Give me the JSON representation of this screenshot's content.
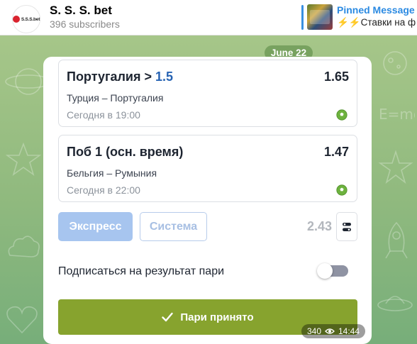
{
  "channel": {
    "title": "S. S. S. bet",
    "subscribers": "396 subscribers",
    "avatar_text": "S.S.S.bet"
  },
  "pinned": {
    "title": "Pinned Message",
    "text": "Ставки на ф",
    "text_prefix": "⚡⚡"
  },
  "date_chip": "June 22",
  "bet_slip": {
    "selections": [
      {
        "market": "Португалия >",
        "line": "1.5",
        "odds": "1.65",
        "match": "Турция – Португалия",
        "time": "Сегодня в 19:00",
        "icon": "soccer-ball-icon"
      },
      {
        "market": "Поб 1 (осн. время)",
        "line": "",
        "odds": "1.47",
        "match": "Бельгия – Румыния",
        "time": "Сегодня в 22:00",
        "icon": "soccer-ball-icon"
      }
    ],
    "express_label": "Экспресс",
    "system_label": "Система",
    "total_odds": "2.43",
    "subscribe_label": "Подписаться на результат пари",
    "subscribe_toggle_on": false,
    "accept_label": "Пари принято"
  },
  "message_meta": {
    "views": "340",
    "time": "14:44"
  },
  "colors": {
    "accent_blue": "#2b8ae2",
    "line_blue": "#2763b3",
    "accept_green": "#87a32e",
    "express_blue": "#a7c5ef",
    "ball_green": "#6db23e"
  }
}
